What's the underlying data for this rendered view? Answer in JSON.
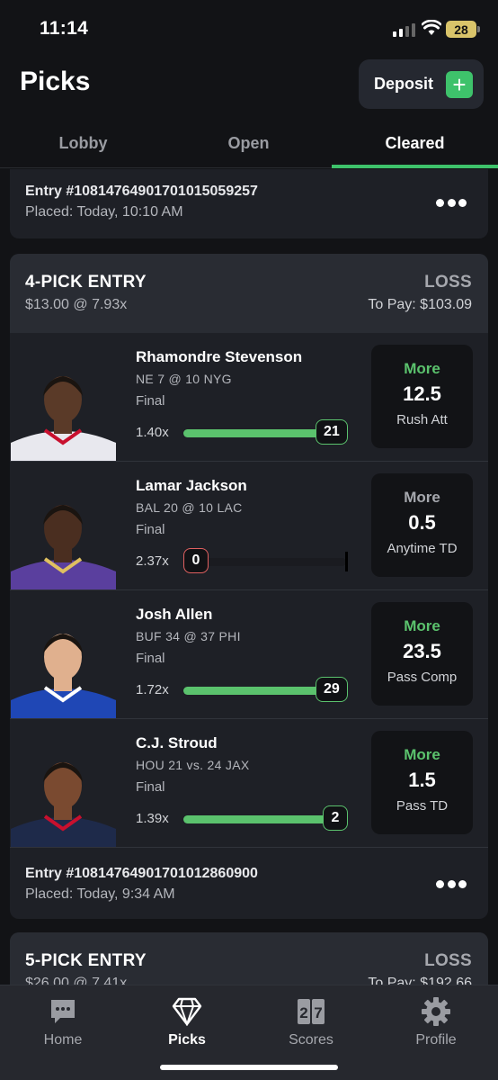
{
  "status_bar": {
    "time": "11:14",
    "battery": "28"
  },
  "header": {
    "title": "Picks",
    "deposit_label": "Deposit",
    "deposit_icon": "plus-icon"
  },
  "tabs": [
    {
      "label": "Lobby",
      "active": false
    },
    {
      "label": "Open",
      "active": false
    },
    {
      "label": "Cleared",
      "active": true
    }
  ],
  "prev_entry": {
    "id": "Entry #1081476490170101505925​7",
    "placed": "Placed: Today, 10:10 AM"
  },
  "entry": {
    "title": "4-PICK ENTRY",
    "odds": "$13.00 @ 7.93x",
    "result": "LOSS",
    "to_pay": "To Pay: $103.09",
    "picks": [
      {
        "name": "Rhamondre Stevenson",
        "matchup": "NE 7 @ 10 NYG",
        "status": "Final",
        "multiplier": "1.40x",
        "actual": "21",
        "progress": 1.0,
        "direction": "More",
        "line": "12.5",
        "stat": "Rush Att",
        "hit": true,
        "jersey": "#e8e8ee",
        "jersey_accent": "#c8102e",
        "skin": "#5a3a28"
      },
      {
        "name": "Lamar Jackson",
        "matchup": "BAL 20 @ 10 LAC",
        "status": "Final",
        "multiplier": "2.37x",
        "actual": "0",
        "progress": 0.0,
        "direction": "More",
        "line": "0.5",
        "stat": "Anytime TD",
        "hit": false,
        "jersey": "#5a3f9e",
        "jersey_accent": "#e0c060",
        "skin": "#4a2e20"
      },
      {
        "name": "Josh Allen",
        "matchup": "BUF 34 @ 37 PHI",
        "status": "Final",
        "multiplier": "1.72x",
        "actual": "29",
        "progress": 1.0,
        "direction": "More",
        "line": "23.5",
        "stat": "Pass Comp",
        "hit": true,
        "jersey": "#1f47b5",
        "jersey_accent": "#ffffff",
        "skin": "#e0b08e"
      },
      {
        "name": "C.J. Stroud",
        "matchup": "HOU 21 vs. 24 JAX",
        "status": "Final",
        "multiplier": "1.39x",
        "actual": "2",
        "progress": 1.0,
        "direction": "More",
        "line": "1.5",
        "stat": "Pass TD",
        "hit": true,
        "jersey": "#1e2a4a",
        "jersey_accent": "#c8102e",
        "skin": "#7a4a30"
      }
    ],
    "entry_id": "Entry #1081476490170101286090​0",
    "placed": "Placed: Today, 9:34 AM"
  },
  "next_entry": {
    "title": "5-PICK ENTRY",
    "odds": "$26.00 @ 7.41x",
    "result": "LOSS",
    "to_pay": "To Pay: $192.66"
  },
  "nav": [
    {
      "label": "Home",
      "icon": "chat-bubble-icon",
      "active": false
    },
    {
      "label": "Picks",
      "icon": "diamond-icon",
      "active": true
    },
    {
      "label": "Scores",
      "icon": "scoreboard-icon",
      "active": false
    },
    {
      "label": "Profile",
      "icon": "gear-icon",
      "active": false
    }
  ],
  "colors": {
    "accent_green": "#3ec26b",
    "loss_red": "#e06060",
    "background": "#121316",
    "card": "#1e2026"
  }
}
